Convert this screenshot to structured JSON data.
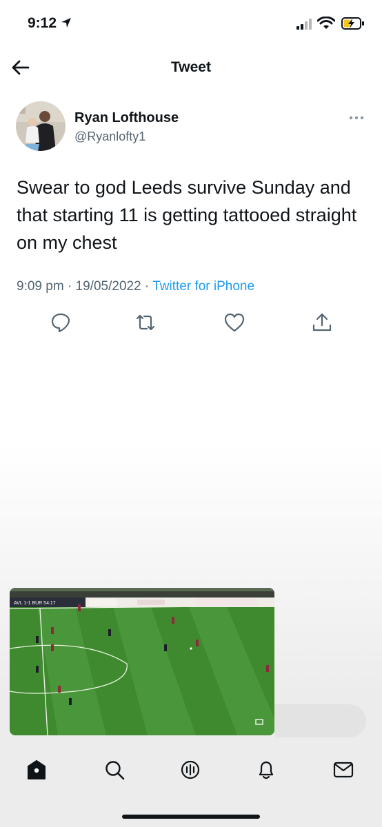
{
  "status_bar": {
    "time": "9:12",
    "location_icon": "location-arrow-icon",
    "signal_icon": "cellular-signal-icon",
    "wifi_icon": "wifi-icon",
    "battery_icon": "battery-charging-icon"
  },
  "header": {
    "title": "Tweet",
    "back_icon": "back-arrow-icon"
  },
  "tweet": {
    "author_name": "Ryan Lofthouse",
    "author_handle": "@Ryanlofty1",
    "text": "Swear to god Leeds survive Sunday and that starting 11 is getting tattooed straight on my chest",
    "time": "9:09 pm",
    "date": "19/05/2022",
    "separator": "·",
    "source": "Twitter for iPhone",
    "more_icon": "more-dots-icon"
  },
  "actions": {
    "reply_icon": "reply-icon",
    "retweet_icon": "retweet-icon",
    "like_icon": "like-heart-icon",
    "share_icon": "share-icon"
  },
  "video": {
    "scoreboard": "AVL 1-1 BUR 54:17"
  },
  "tab_bar": {
    "items": [
      "home-icon",
      "search-icon",
      "spaces-icon",
      "notifications-icon",
      "messages-icon"
    ]
  },
  "colors": {
    "accent": "#1d9bf0",
    "text_primary": "#0f1419",
    "text_secondary": "#536471",
    "pitch_green": "#3f8a2f"
  }
}
